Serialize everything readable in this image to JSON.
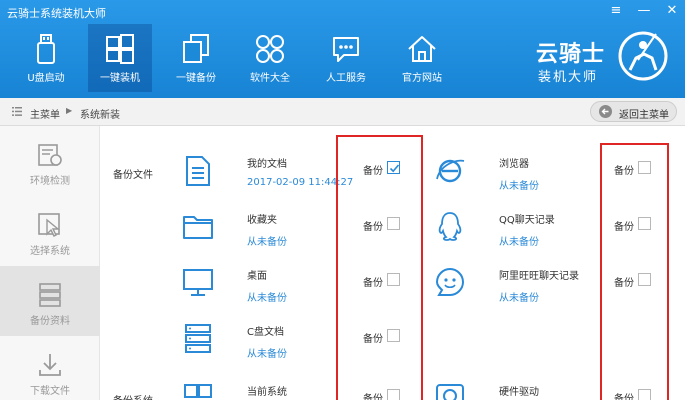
{
  "window": {
    "title": "云骑士系统装机大师",
    "controls": [
      "≡",
      "—",
      "✕"
    ]
  },
  "toolbar": [
    {
      "label": "U盘启动",
      "icon": "usb-drive-icon",
      "active": false
    },
    {
      "label": "一键装机",
      "icon": "windows-logo-icon",
      "active": true
    },
    {
      "label": "一键备份",
      "icon": "backup-copy-icon",
      "active": false
    },
    {
      "label": "软件大全",
      "icon": "apps-grid-icon",
      "active": false
    },
    {
      "label": "人工服务",
      "icon": "chat-bubble-icon",
      "active": false
    },
    {
      "label": "官方网站",
      "icon": "home-icon",
      "active": false
    }
  ],
  "logo": {
    "line1": "云骑士",
    "line2": "装机大师"
  },
  "breadcrumb": {
    "items": [
      "主菜单",
      "系统新装"
    ],
    "back_button": "返回主菜单"
  },
  "sidebar": [
    {
      "label": "环境检测",
      "icon": "environment-check-icon",
      "active": false
    },
    {
      "label": "选择系统",
      "icon": "select-system-cursor-icon",
      "active": false
    },
    {
      "label": "备份资料",
      "icon": "backup-data-icon",
      "active": true
    },
    {
      "label": "下载文件",
      "icon": "download-icon",
      "active": false
    }
  ],
  "content": {
    "section_files": "备份文件",
    "section_system": "备份系统",
    "backup_label": "备份",
    "left_items": [
      {
        "name": "我的文档",
        "sub": "2017-02-09 11:44:27",
        "icon": "document-icon",
        "checked": true
      },
      {
        "name": "收藏夹",
        "sub": "从未备份",
        "icon": "folder-icon",
        "checked": false
      },
      {
        "name": "桌面",
        "sub": "从未备份",
        "icon": "desktop-monitor-icon",
        "checked": false
      },
      {
        "name": "C盘文档",
        "sub": "从未备份",
        "icon": "drive-c-icon",
        "checked": false
      },
      {
        "name": "当前系统",
        "sub": "",
        "icon": "windows-system-icon",
        "checked": false
      }
    ],
    "right_items": [
      {
        "name": "浏览器",
        "sub": "从未备份",
        "icon": "browser-ie-icon",
        "checked": false
      },
      {
        "name": "QQ聊天记录",
        "sub": "从未备份",
        "icon": "qq-penguin-icon",
        "checked": false
      },
      {
        "name": "阿里旺旺聊天记录",
        "sub": "从未备份",
        "icon": "aliwangwang-icon",
        "checked": false
      },
      {
        "name": "硬件驱动",
        "sub": "",
        "icon": "hardware-driver-icon",
        "checked": false
      }
    ]
  }
}
